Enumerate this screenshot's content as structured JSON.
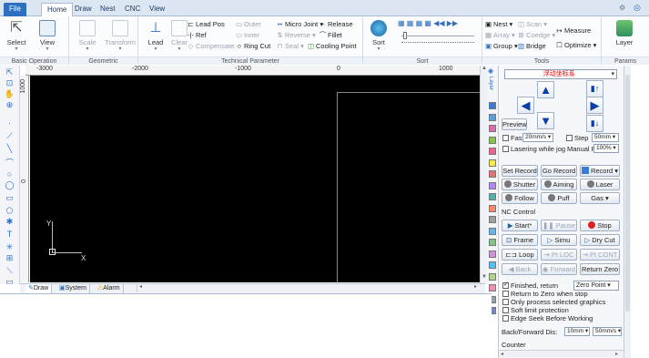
{
  "tabs": {
    "file": "File",
    "home": "Home",
    "draw": "Draw",
    "nest": "Nest",
    "cnc": "CNC",
    "view": "View"
  },
  "ribbon": {
    "basic": {
      "caption": "Basic Operation",
      "select": "Select",
      "view": "View"
    },
    "geo": {
      "caption": "Geometric transformation",
      "scale": "Scale",
      "transform": "Transform"
    },
    "tech": {
      "caption": "Technical Parameter",
      "lead": "Lead",
      "clear": "Clear",
      "lead_pos": "Lead Pos",
      "ref": "Ref",
      "compensate": "Compensate",
      "outer": "Outer",
      "inner": "Inner",
      "ring_cut": "Ring Cut",
      "micro_joint": "Micro Joint",
      "reverse": "Reverse",
      "seal": "Seal",
      "release": "Release",
      "fillet": "Fillet",
      "cooling_point": "Cooling Point"
    },
    "sort": {
      "caption": "Sort",
      "sort": "Sort"
    },
    "tools": {
      "caption": "Tools",
      "nest": "Nest",
      "array": "Array",
      "group": "Group",
      "scan": "Scan",
      "coedge": "Coedge",
      "bridge": "Bridge",
      "measure": "Measure",
      "optimize": "Optimize"
    },
    "params": {
      "caption": "Params",
      "layer": "Layer"
    }
  },
  "rulers": {
    "h": [
      "-3000",
      "-2000",
      "-1000",
      "0",
      "1000"
    ],
    "v": [
      "1000",
      "0"
    ]
  },
  "canvas": {
    "y_axis": "Y",
    "x_axis": "X"
  },
  "bottom_tabs": {
    "draw": "Draw",
    "system": "System",
    "alarm": "Alarm"
  },
  "panel": {
    "coord_system": "浮动坐标系",
    "preview": "Preview",
    "fast": "Fast",
    "fast_speed": "20mm/s",
    "step": "Step",
    "step_size": "50mm",
    "lasering_while_jog": "Lasering while jog",
    "manual_pw": "Manual Pw",
    "manual_pw_value": "100%",
    "set_record": "Set Record",
    "go_record": "Go Record",
    "record": "Record",
    "shutter": "Shutter",
    "aiming": "Aiming",
    "laser": "Laser",
    "follow": "Follow",
    "puff": "Puff",
    "gas": "Gas",
    "nc_control": "NC Control",
    "start": "Start*",
    "pause": "Pause",
    "stop": "Stop",
    "frame": "Frame",
    "simu": "Simu",
    "dry_cut": "Dry Cut",
    "loop": "Loop",
    "pt_loc": "Pt LOC",
    "pt_cont": "Pt CONT",
    "back": "Back",
    "forward": "Forward",
    "return_zero": "Return Zero",
    "finished_return": "Finished, return",
    "finished_return_target": "Zero Point",
    "return_zero_when_stop": "Return to Zero when stop",
    "only_selected": "Only process selected graphics",
    "soft_limit": "Soft limit protection",
    "edge_seek": "Edge Seek Before Working",
    "back_forward_dis": "Back/Forward Dis:",
    "dis_value": "10mm",
    "dis_speed": "50mm/s",
    "counter": "Counter"
  },
  "colors": {
    "layers": [
      "#3a7bd5",
      "#57a0e0",
      "#e06aa8",
      "#8bc34a",
      "#f06292",
      "#ffeb3b",
      "#e57373",
      "#b388ff",
      "#4db6ac",
      "#ff8a65",
      "#9e9e9e",
      "#64b5f6",
      "#81c784",
      "#ce93d8",
      "#4fc3f7",
      "#aed581",
      "#f48fb1",
      "#90a4ae",
      "#7986cb"
    ]
  }
}
